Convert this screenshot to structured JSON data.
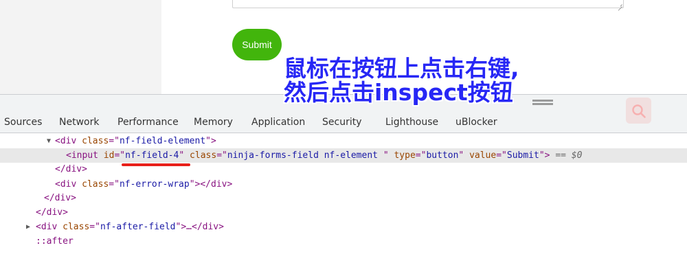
{
  "page": {
    "submit_label": "Submit"
  },
  "annotation": {
    "line1": "鼠标在按钮上点击右键,",
    "line2": "然后点击inspect按钮",
    "color": "#2727f5"
  },
  "devtools": {
    "tabs": [
      "Sources",
      "Network",
      "Performance",
      "Memory",
      "Application",
      "Security",
      "Lighthouse",
      "uBlocker"
    ],
    "search_icon": "search-icon",
    "dom_lines": {
      "line1": {
        "tag": "div",
        "attr_name": "class",
        "attr_value": "nf-field-element"
      },
      "line2": {
        "tag": "input",
        "a1_name": "id",
        "a1_value": "nf-field-4",
        "a2_name": "class",
        "a2_value": "ninja-forms-field nf-element ",
        "a3_name": "type",
        "a3_value": "button",
        "a4_name": "value",
        "a4_value": "Submit",
        "suffix": " == $0"
      },
      "line3": "</div>",
      "line4": {
        "tag": "div",
        "attr_name": "class",
        "attr_value": "nf-error-wrap",
        "close": "</div>"
      },
      "line5": "</div>",
      "line6": "</div>",
      "line7": {
        "tag": "div",
        "attr_name": "class",
        "attr_value": "nf-after-field",
        "ellipsis": "…",
        "close": "</div>"
      },
      "line8": "::after"
    }
  },
  "colors": {
    "submit_green": "#42b50c",
    "highlight_red": "#e8201a",
    "selected_row": "#e8e8e8"
  }
}
